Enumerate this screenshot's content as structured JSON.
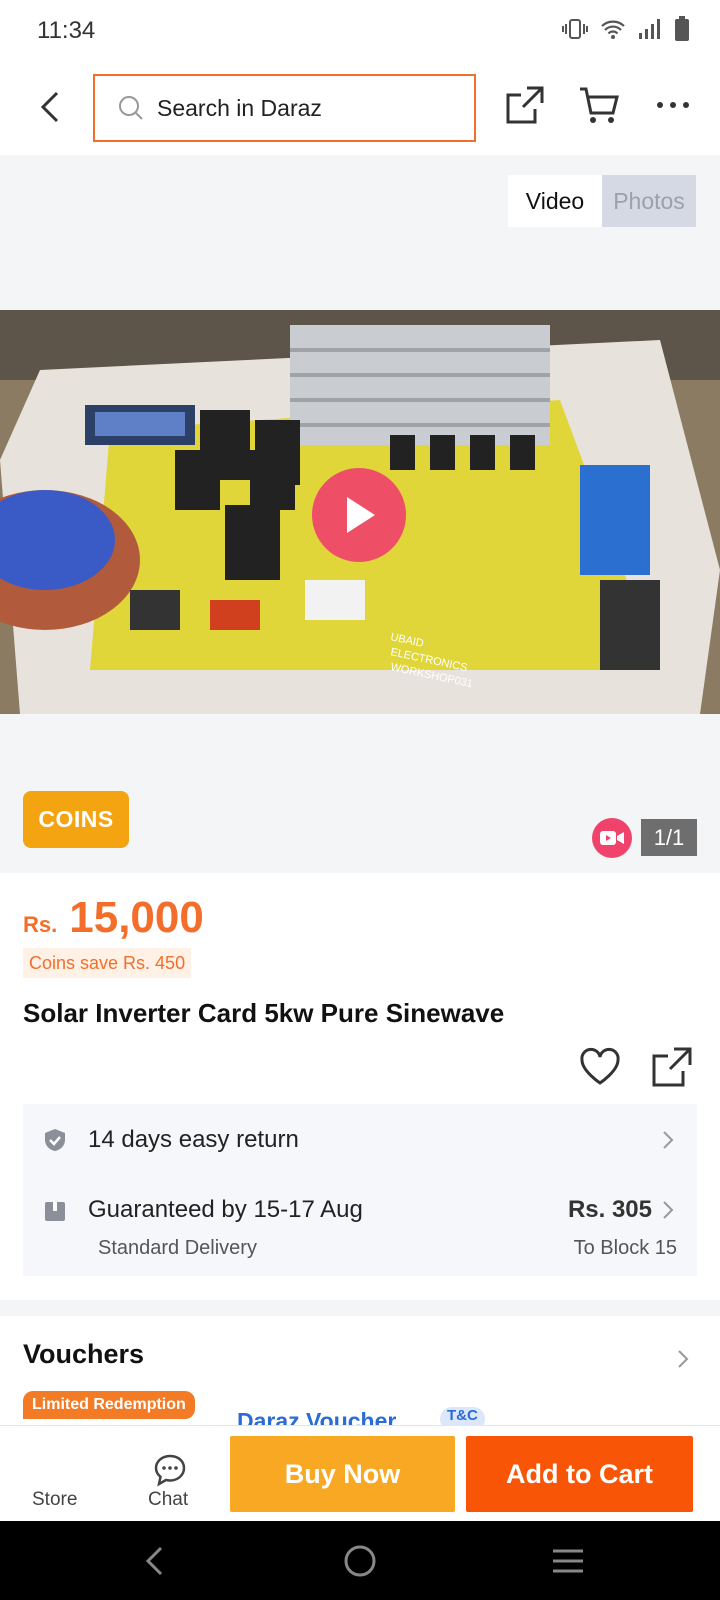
{
  "status_bar": {
    "time": "11:34",
    "icons": [
      "vibrate-icon",
      "wifi-icon",
      "signal-icon",
      "battery-icon"
    ]
  },
  "header": {
    "search_placeholder": "Search in Daraz",
    "accent": "#f36e2a"
  },
  "gallery": {
    "tabs": [
      {
        "label": "Video",
        "active": true
      },
      {
        "label": "Photos",
        "active": false
      }
    ],
    "coins_badge": "COINS",
    "counter": "1/1"
  },
  "product": {
    "currency": "Rs.",
    "price": "15,000",
    "coins_save": "Coins save Rs. 450",
    "title": "Solar Inverter Card 5kw Pure Sinewave",
    "price_color": "#f36e2a"
  },
  "delivery": {
    "return_text": "14 days easy return",
    "guarantee_text": "Guaranteed by 15-17 Aug",
    "delivery_type": "Standard Delivery",
    "delivery_fee": "Rs. 305",
    "destination": "To Block 15"
  },
  "vouchers": {
    "title": "Vouchers",
    "tag": "Limited Redemption",
    "voucher_name": "Daraz Voucher",
    "tc": "T&C"
  },
  "action_bar": {
    "store_label": "Store",
    "chat_label": "Chat",
    "buy_now": "Buy Now",
    "add_to_cart": "Add to Cart",
    "buy_color": "#f9a823",
    "cart_color": "#f85606"
  }
}
